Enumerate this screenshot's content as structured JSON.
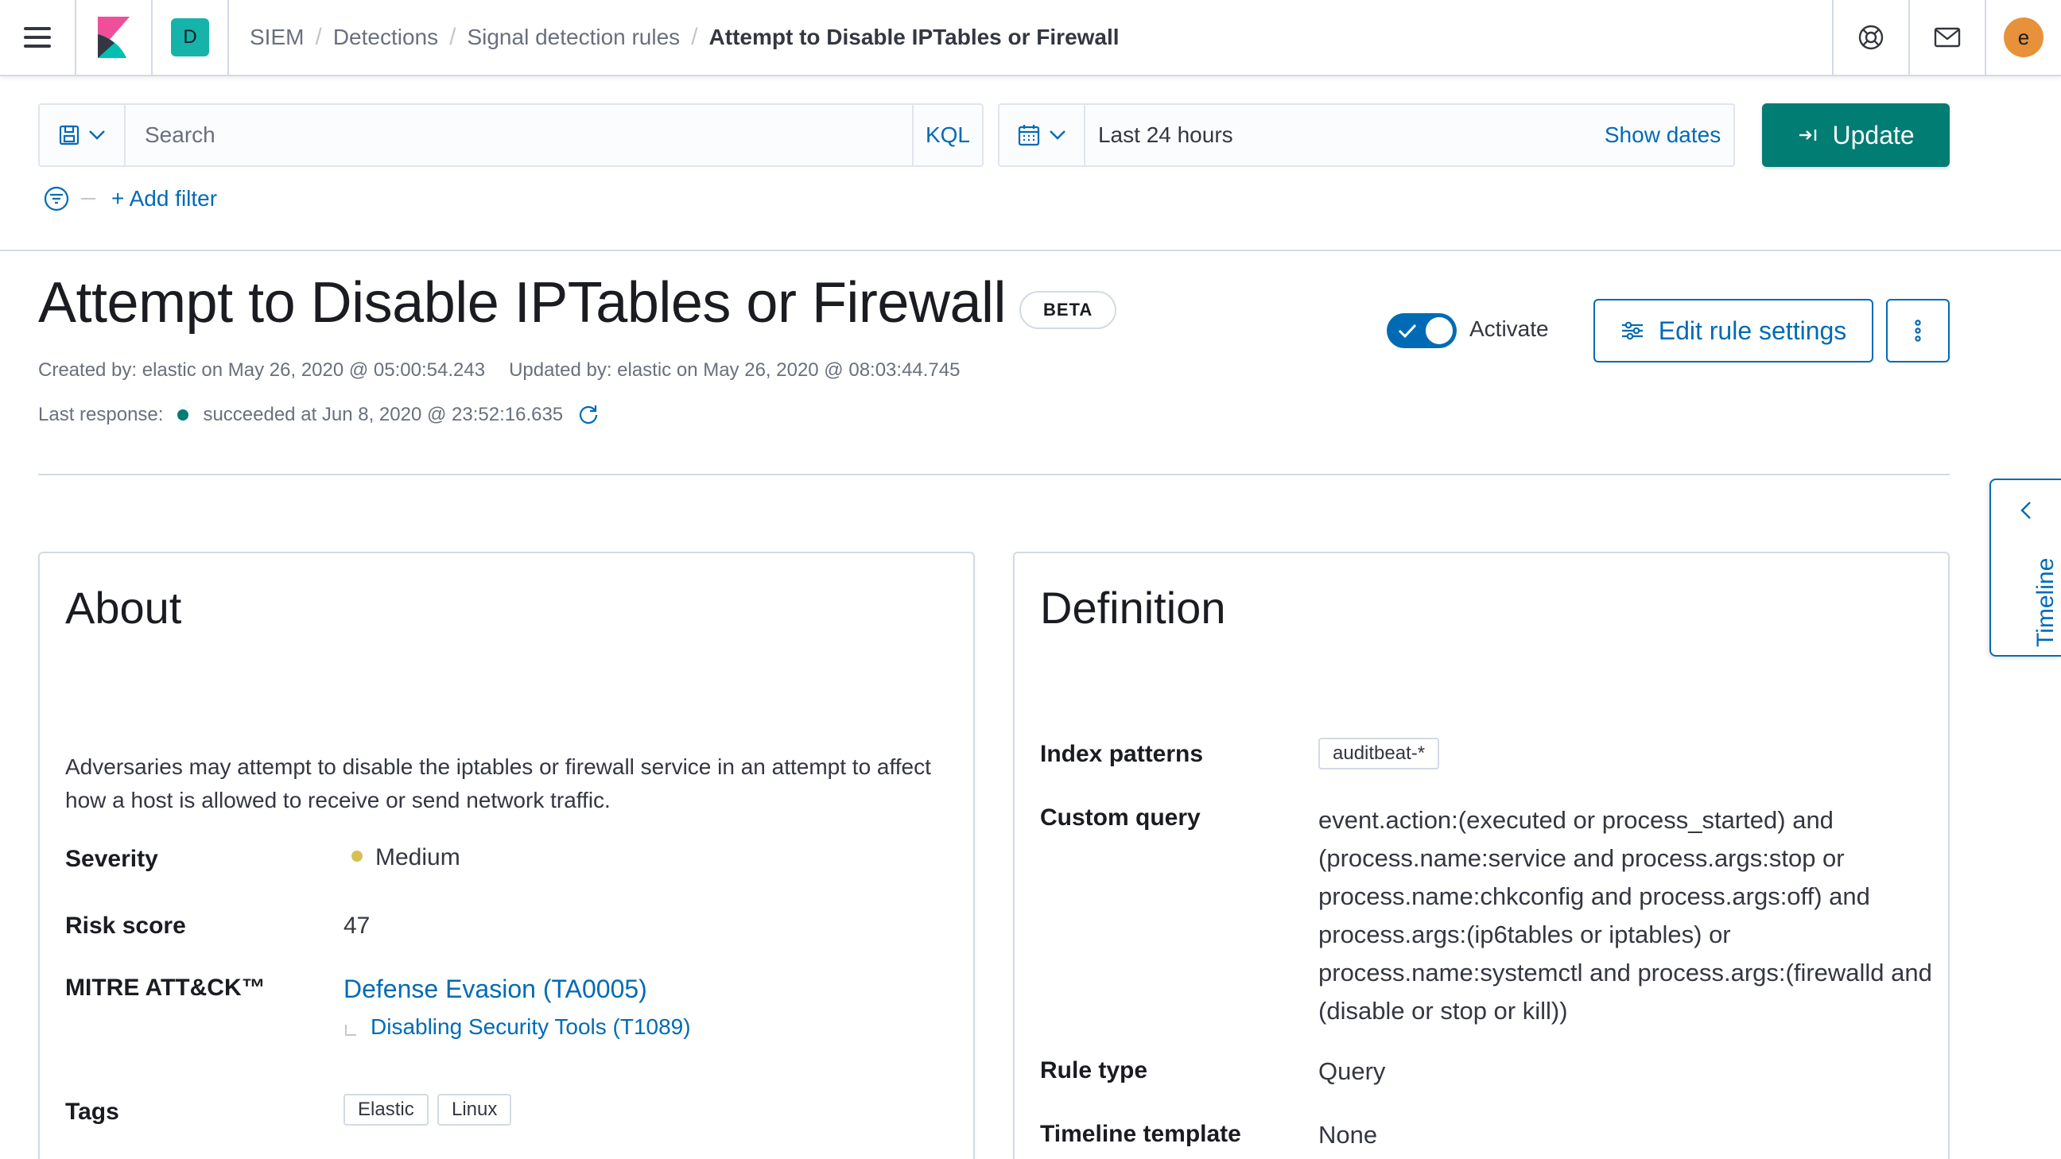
{
  "header": {
    "space_initial": "D",
    "breadcrumbs": [
      "SIEM",
      "Detections",
      "Signal detection rules",
      "Attempt to Disable IPTables or Firewall"
    ],
    "user_initial": "e"
  },
  "querybar": {
    "search_placeholder": "Search",
    "kql_label": "KQL",
    "date_range": "Last 24 hours",
    "show_dates_label": "Show dates",
    "update_label": "Update",
    "add_filter_label": "+ Add filter"
  },
  "rule": {
    "title": "Attempt to Disable IPTables or Firewall",
    "badge": "BETA",
    "created_by": "Created by: elastic on May 26, 2020 @ 05:00:54.243",
    "updated_by": "Updated by: elastic on May 26, 2020 @ 08:03:44.745",
    "last_response_label": "Last response:",
    "last_response_status": "succeeded",
    "last_response_time": "at Jun 8, 2020 @ 23:52:16.635",
    "activate_label": "Activate",
    "activated": true,
    "edit_label": "Edit rule settings"
  },
  "timeline": {
    "label": "Timeline"
  },
  "about": {
    "title": "About",
    "description": "Adversaries may attempt to disable the iptables or firewall service in an attempt to affect how a host is allowed to receive or send network traffic.",
    "severity_label": "Severity",
    "severity_value": "Medium",
    "risk_label": "Risk score",
    "risk_value": "47",
    "mitre_label": "MITRE ATT&CK™",
    "mitre_tactic": "Defense Evasion (TA0005)",
    "mitre_technique": "Disabling Security Tools (T1089)",
    "tags_label": "Tags",
    "tags": [
      "Elastic",
      "Linux"
    ]
  },
  "definition": {
    "title": "Definition",
    "index_label": "Index patterns",
    "index_value": "auditbeat-*",
    "query_label": "Custom query",
    "query_value": "event.action:(executed or process_started) and (process.name:service and process.args:stop or process.name:chkconfig and process.args:off) and process.args:(ip6tables or iptables) or process.name:systemctl and process.args:(firewalld and (disable or stop or kill))",
    "rule_type_label": "Rule type",
    "rule_type_value": "Query",
    "template_label": "Timeline template",
    "template_value": "None"
  },
  "colors": {
    "primary": "#006bb4",
    "success": "#017d73",
    "warning": "#d6bf57",
    "space": "#16b3ab",
    "user": "#e7923a"
  },
  "icons": [
    "menu-icon",
    "kibana-logo-icon",
    "help-icon",
    "mail-icon",
    "save-icon",
    "chevron-down-icon",
    "calendar-icon",
    "refresh-icon",
    "filter-icon",
    "check-icon",
    "settings-icon",
    "more-vertical-icon",
    "chevron-left-icon",
    "timeline-icon"
  ]
}
